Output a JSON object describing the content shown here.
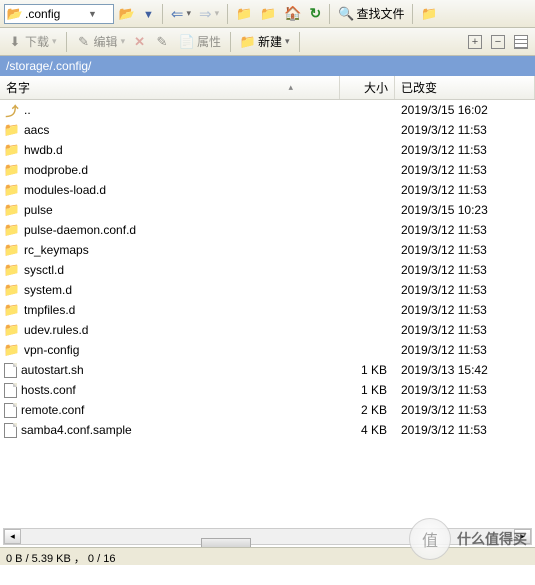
{
  "toolbar": {
    "address_value": ".config",
    "download_label": "下载",
    "edit_label": "编辑",
    "props_label": "属性",
    "new_label": "新建",
    "search_label": "查找文件"
  },
  "path": "/storage/.config/",
  "columns": {
    "name": "名字",
    "size": "大小",
    "changed": "已改变"
  },
  "files": [
    {
      "icon": "up",
      "name": "..",
      "size": "",
      "date": "2019/3/15 16:02"
    },
    {
      "icon": "folder",
      "name": "aacs",
      "size": "",
      "date": "2019/3/12 11:53"
    },
    {
      "icon": "folder",
      "name": "hwdb.d",
      "size": "",
      "date": "2019/3/12 11:53"
    },
    {
      "icon": "folder",
      "name": "modprobe.d",
      "size": "",
      "date": "2019/3/12 11:53"
    },
    {
      "icon": "folder",
      "name": "modules-load.d",
      "size": "",
      "date": "2019/3/12 11:53"
    },
    {
      "icon": "folder",
      "name": "pulse",
      "size": "",
      "date": "2019/3/15 10:23"
    },
    {
      "icon": "folder",
      "name": "pulse-daemon.conf.d",
      "size": "",
      "date": "2019/3/12 11:53"
    },
    {
      "icon": "folder",
      "name": "rc_keymaps",
      "size": "",
      "date": "2019/3/12 11:53"
    },
    {
      "icon": "folder",
      "name": "sysctl.d",
      "size": "",
      "date": "2019/3/12 11:53"
    },
    {
      "icon": "folder",
      "name": "system.d",
      "size": "",
      "date": "2019/3/12 11:53"
    },
    {
      "icon": "folder",
      "name": "tmpfiles.d",
      "size": "",
      "date": "2019/3/12 11:53"
    },
    {
      "icon": "folder",
      "name": "udev.rules.d",
      "size": "",
      "date": "2019/3/12 11:53"
    },
    {
      "icon": "folder",
      "name": "vpn-config",
      "size": "",
      "date": "2019/3/12 11:53"
    },
    {
      "icon": "file",
      "name": "autostart.sh",
      "size": "1 KB",
      "date": "2019/3/13 15:42"
    },
    {
      "icon": "file",
      "name": "hosts.conf",
      "size": "1 KB",
      "date": "2019/3/12 11:53"
    },
    {
      "icon": "file",
      "name": "remote.conf",
      "size": "2 KB",
      "date": "2019/3/12 11:53"
    },
    {
      "icon": "file",
      "name": "samba4.conf.sample",
      "size": "4 KB",
      "date": "2019/3/12 11:53"
    }
  ],
  "status": "0 B / 5.39 KB ， 0 / 16",
  "watermark": "什么值得买"
}
